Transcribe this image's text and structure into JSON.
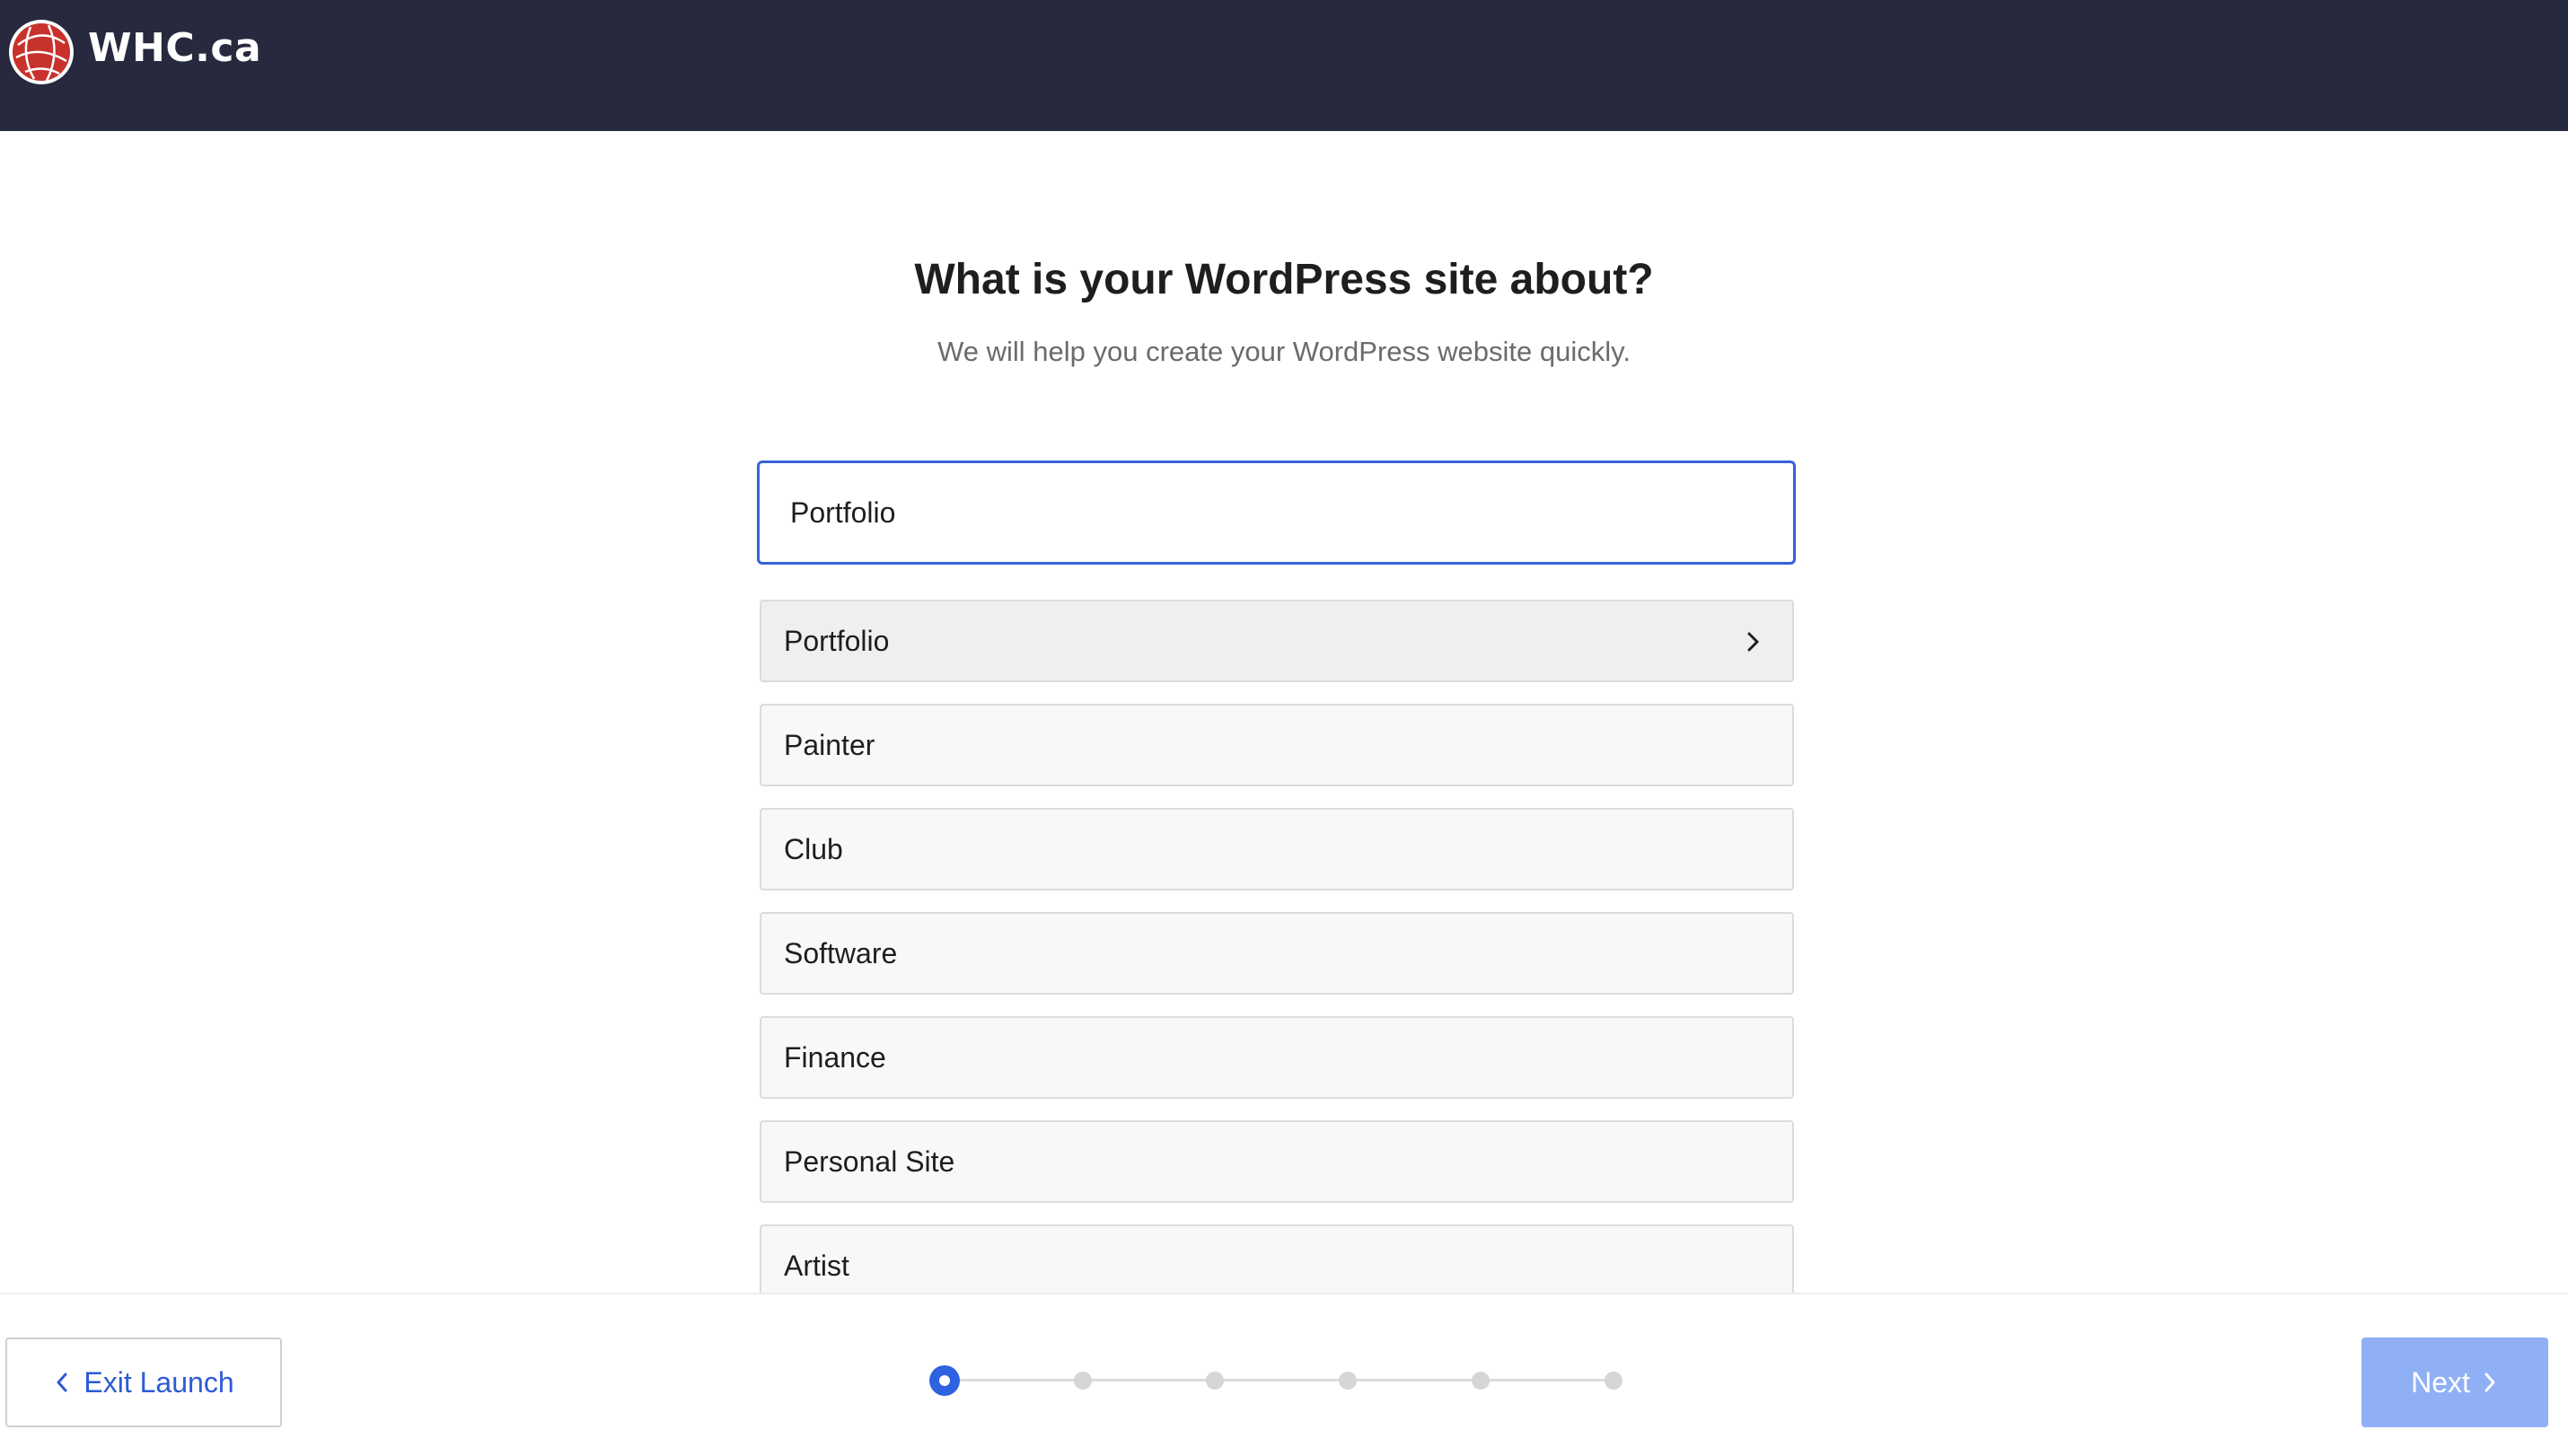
{
  "header": {
    "logo_text": "WHC.ca",
    "logo_icon": "whc-globe-logo-icon",
    "background": "#272a3e"
  },
  "main": {
    "title": "What is your WordPress site about?",
    "subtitle": "We will help you create your WordPress website quickly.",
    "search": {
      "value": "Portfolio",
      "placeholder": ""
    },
    "options": [
      {
        "label": "Portfolio",
        "active": true
      },
      {
        "label": "Painter",
        "active": false
      },
      {
        "label": "Club",
        "active": false
      },
      {
        "label": "Software",
        "active": false
      },
      {
        "label": "Finance",
        "active": false
      },
      {
        "label": "Personal Site",
        "active": false
      },
      {
        "label": "Artist",
        "active": false
      }
    ]
  },
  "footer": {
    "exit_label": "Exit Launch",
    "next_label": "Next",
    "steps_total": 6,
    "current_step": 1,
    "accent_color": "#2f62e0",
    "next_disabled_color": "#8fb0f5"
  }
}
